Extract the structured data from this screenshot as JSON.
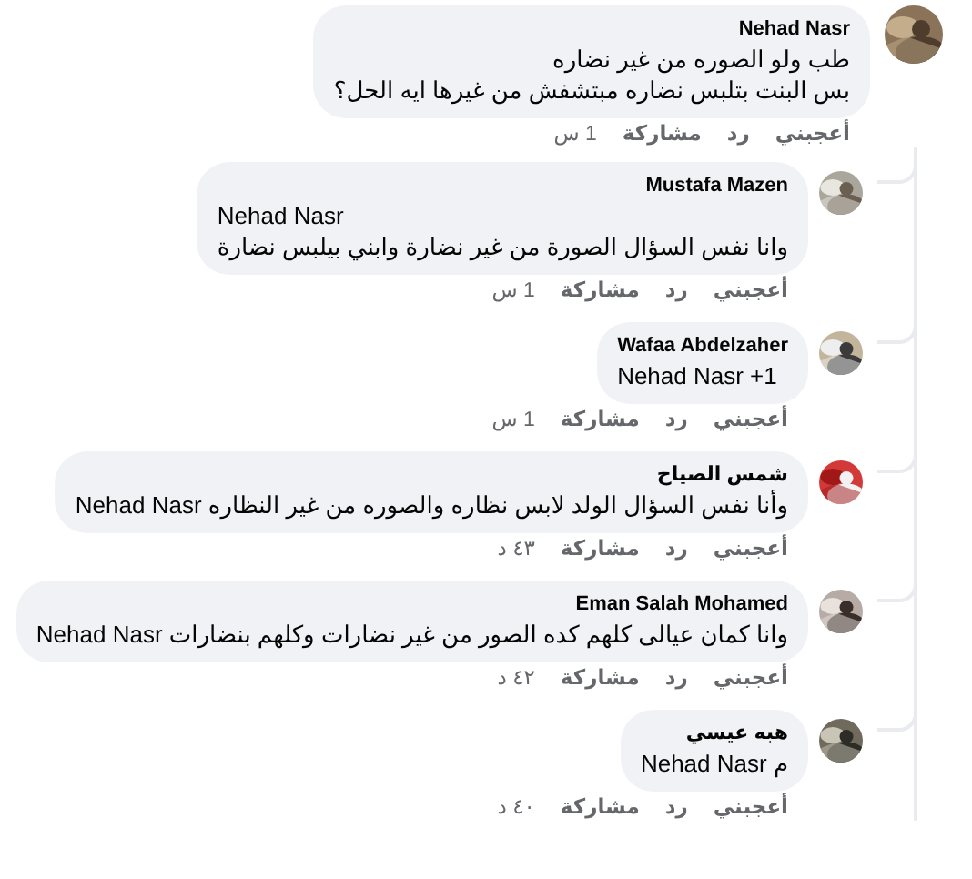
{
  "comment": {
    "author": "Nehad Nasr",
    "lines": [
      "طب ولو الصوره من غير نضاره",
      "بس البنت بتلبس نضاره مبتشفش من غيرها ايه الحل؟"
    ],
    "actions": {
      "like": "أعجبني",
      "reply": "رد",
      "share": "مشاركة",
      "time": "1 س"
    },
    "replies": [
      {
        "author": "Mustafa Mazen",
        "lines": [
          "Nehad Nasr",
          "وانا نفس السؤال الصورة من غير نضارة وابني بيلبس نضارة"
        ],
        "actions": {
          "like": "أعجبني",
          "reply": "رد",
          "share": "مشاركة",
          "time": "1 س"
        }
      },
      {
        "author": "Wafaa Abdelzaher",
        "lines": [
          "Nehad Nasr +1"
        ],
        "actions": {
          "like": "أعجبني",
          "reply": "رد",
          "share": "مشاركة",
          "time": "1 س"
        }
      },
      {
        "author": "شمس الصياح",
        "lines": [
          "وأنا نفس السؤال الولد لابس نظاره والصوره من غير النظاره Nehad Nasr"
        ],
        "actions": {
          "like": "أعجبني",
          "reply": "رد",
          "share": "مشاركة",
          "time": "٤٣ د"
        }
      },
      {
        "author": "Eman Salah Mohamed",
        "lines": [
          "وانا كمان عيالى كلهم كده الصور من غير نضارات وكلهم بنضارات Nehad Nasr"
        ],
        "actions": {
          "like": "أعجبني",
          "reply": "رد",
          "share": "مشاركة",
          "time": "٤٢ د"
        }
      },
      {
        "author": "هبه عيسي",
        "lines": [
          "م Nehad Nasr"
        ],
        "actions": {
          "like": "أعجبني",
          "reply": "رد",
          "share": "مشاركة",
          "time": "٤٠ د"
        }
      }
    ]
  }
}
